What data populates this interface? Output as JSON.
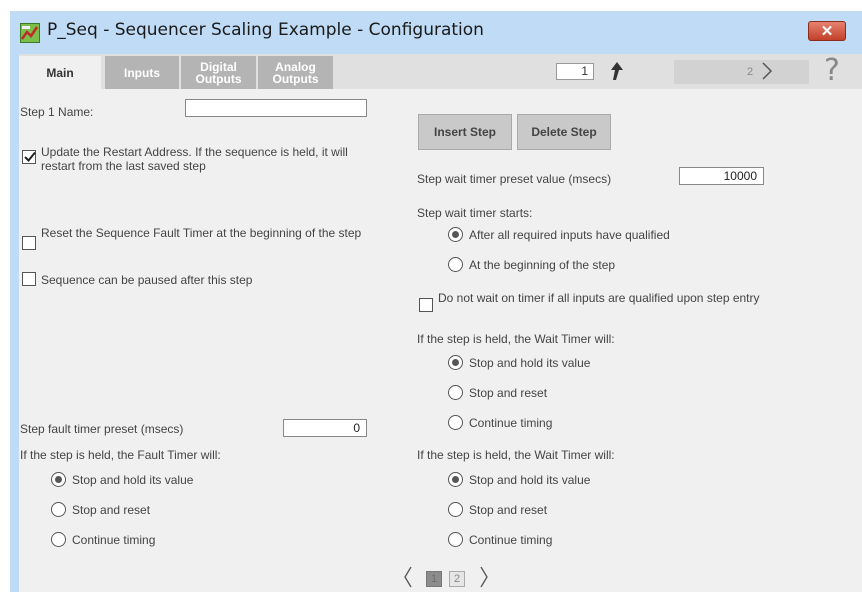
{
  "window": {
    "title": "P_Seq - Sequencer Scaling Example - Configuration",
    "close_label": "✕"
  },
  "tabs": [
    {
      "label": "Main",
      "active": true
    },
    {
      "label": "Inputs",
      "active": false
    },
    {
      "label": "Digital Outputs",
      "active": false
    },
    {
      "label": "Analog Outputs",
      "active": false
    }
  ],
  "nav": {
    "step_value": "1",
    "next_step_label": "2",
    "help_label": "?"
  },
  "left": {
    "step_name_label": "Step 1 Name:",
    "step_name_value": "",
    "update_restart_text": "Update the Restart Address.  If the sequence is held, it will restart from the last saved step",
    "update_restart_checked": true,
    "reset_fault_timer_text": "Reset the Sequence Fault Timer at the beginning of the step",
    "reset_fault_timer_checked": false,
    "can_pause_text": "Sequence can be paused after this step",
    "can_pause_checked": false,
    "fault_preset_label": "Step fault timer preset (msecs)",
    "fault_preset_value": "0",
    "fault_held_label": "If the step is held, the Fault Timer will:",
    "fault_options": [
      {
        "label": "Stop and hold its value",
        "selected": true
      },
      {
        "label": "Stop and reset",
        "selected": false
      },
      {
        "label": "Continue timing",
        "selected": false
      }
    ]
  },
  "right": {
    "insert_step_label": "Insert Step",
    "delete_step_label": "Delete Step",
    "wait_preset_label": "Step wait timer preset value (msecs)",
    "wait_preset_value": "10000",
    "wait_starts_label": "Step wait timer starts:",
    "wait_start_options": [
      {
        "label": "After all required inputs have qualified",
        "selected": true
      },
      {
        "label": "At the beginning of the step",
        "selected": false
      }
    ],
    "no_wait_text": "Do not wait on timer if all inputs are qualified upon step entry",
    "no_wait_checked": false,
    "wait_held_label_1": "If the step is held, the Wait Timer will:",
    "wait_held_options_1": [
      {
        "label": "Stop and hold its value",
        "selected": true
      },
      {
        "label": "Stop and reset",
        "selected": false
      },
      {
        "label": "Continue timing",
        "selected": false
      }
    ],
    "wait_held_label_2": "If the step is held, the Wait Timer will:",
    "wait_held_options_2": [
      {
        "label": "Stop and hold its value",
        "selected": true
      },
      {
        "label": "Stop and reset",
        "selected": false
      },
      {
        "label": "Continue timing",
        "selected": false
      }
    ]
  },
  "pager": {
    "pages": [
      "1",
      "2"
    ],
    "current": "1"
  },
  "colors": {
    "window_bg": "#bfdbf5",
    "content_bg": "#f0f0f0",
    "tab_inactive": "#b4b4b4",
    "close_red": "#c2402a"
  }
}
